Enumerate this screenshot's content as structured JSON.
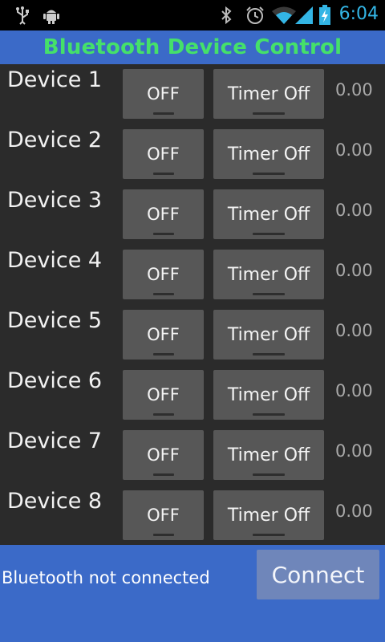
{
  "status_bar": {
    "time": "6:04",
    "icons": [
      "usb-icon",
      "android-debug-icon",
      "bluetooth-icon",
      "alarm-icon",
      "wifi-icon",
      "signal-icon",
      "battery-charging-icon"
    ],
    "time_color": "#33b5e5"
  },
  "header": {
    "title": "Bluetooth Device Control",
    "title_color": "#45e06a",
    "bg_color": "#3b6ac8"
  },
  "devices": [
    {
      "label": "Device 1",
      "toggle": "OFF",
      "timer": "Timer Off",
      "value": "0.00"
    },
    {
      "label": "Device 2",
      "toggle": "OFF",
      "timer": "Timer Off",
      "value": "0.00"
    },
    {
      "label": "Device 3",
      "toggle": "OFF",
      "timer": "Timer Off",
      "value": "0.00"
    },
    {
      "label": "Device 4",
      "toggle": "OFF",
      "timer": "Timer Off",
      "value": "0.00"
    },
    {
      "label": "Device 5",
      "toggle": "OFF",
      "timer": "Timer Off",
      "value": "0.00"
    },
    {
      "label": "Device 6",
      "toggle": "OFF",
      "timer": "Timer Off",
      "value": "0.00"
    },
    {
      "label": "Device 7",
      "toggle": "OFF",
      "timer": "Timer Off",
      "value": "0.00"
    },
    {
      "label": "Device 8",
      "toggle": "OFF",
      "timer": "Timer Off",
      "value": "0.00"
    }
  ],
  "footer": {
    "status": "Bluetooth not connected",
    "connect_label": "Connect"
  }
}
